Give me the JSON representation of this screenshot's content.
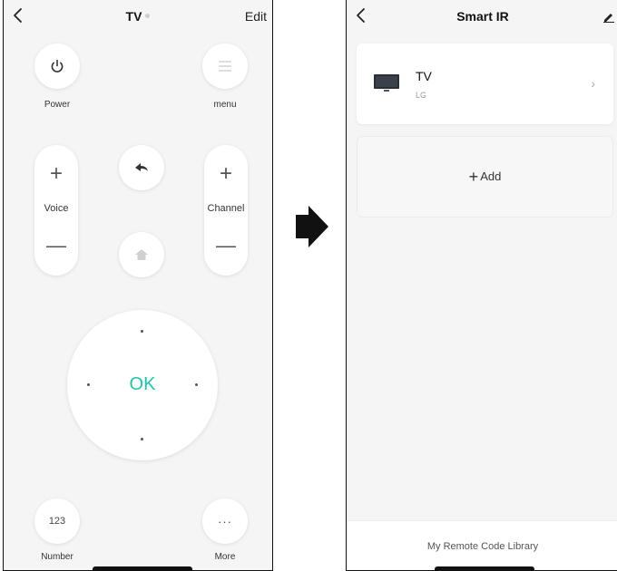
{
  "left": {
    "title": "TV",
    "edit_label": "Edit",
    "power_label": "Power",
    "menu_label": "menu",
    "voice_label": "Voice",
    "channel_label": "Channel",
    "ok_label": "OK",
    "number_button": "123",
    "number_label": "Number",
    "more_button": "···",
    "more_label": "More",
    "accent_color": "#1cc7a8"
  },
  "right": {
    "title": "Smart IR",
    "device": {
      "name": "TV",
      "brand": "LG"
    },
    "add_label": "Add",
    "library_label": "My Remote Code Library"
  }
}
